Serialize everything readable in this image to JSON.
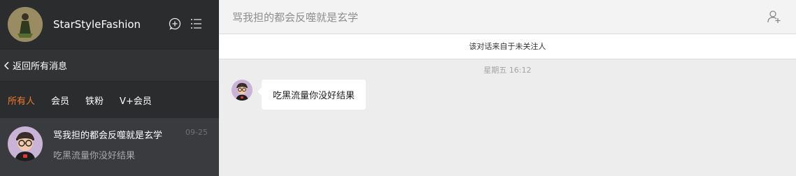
{
  "profile": {
    "name": "StarStyleFashion",
    "avatar_icon": "profile-avatar-icon"
  },
  "toolbar": {
    "new_chat_icon": "plus-circle-icon",
    "menu_icon": "list-icon"
  },
  "nav": {
    "back_label": "返回所有消息"
  },
  "filters": [
    {
      "label": "所有人",
      "active": true
    },
    {
      "label": "会员",
      "active": false
    },
    {
      "label": "铁粉",
      "active": false
    },
    {
      "label": "V+会员",
      "active": false
    }
  ],
  "conversations": [
    {
      "title": "骂我担的都会反噬就是玄学",
      "preview": "吃黑流量你没好结果",
      "date": "09-25"
    }
  ],
  "chat": {
    "title": "骂我担的都会反噬就是玄学",
    "notice": "该对话来自于未关注人",
    "timestamp": "星期五 16:12",
    "messages": [
      {
        "text": "吃黑流量你没好结果"
      }
    ]
  },
  "colors": {
    "accent": "#f07a2b",
    "sidebar_bg": "#2b2c2e",
    "chat_bg": "#ededed"
  }
}
